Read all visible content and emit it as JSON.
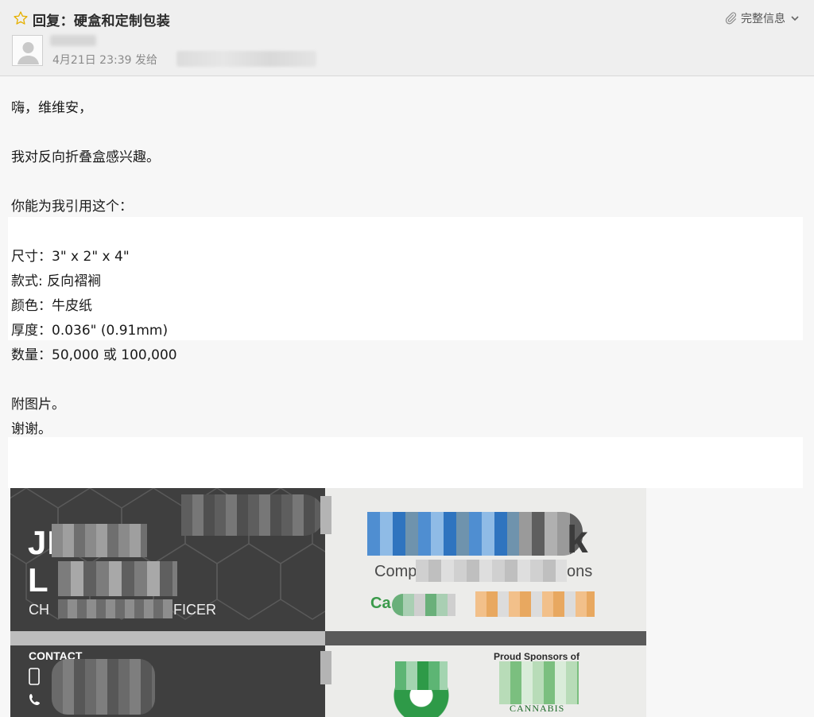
{
  "header": {
    "subject": "回复：硬盒和定制包装",
    "full_info_label": "完整信息",
    "date_time": "4月21日 23:39",
    "sent_to_label": "发给"
  },
  "body": {
    "greeting": "嗨，维维安，",
    "interest": "我对反向折叠盒感兴趣。",
    "request": "你能为我引用这个：",
    "specs": [
      "尺寸：3\" x 2\" x 4\"",
      "款式: 反向褶裥",
      "颜色：牛皮纸",
      "厚度：0.036\" (0.91mm)",
      "数量：50,000 或 100,000"
    ],
    "attachment_note": "附图片。",
    "thanks": "谢谢。"
  },
  "card": {
    "name_line1": "JE",
    "name_line2": "L",
    "title_start": "CH",
    "title_end": "FICER",
    "contact_label": "CONTACT",
    "comp_text": "Comp",
    "ons_text": "ons",
    "brand_k": "k",
    "ca_text": "Ca",
    "sponsors_text": "Proud Sponsors of",
    "cannabis_text": "CANNABIS"
  },
  "colors": {
    "header_bg": "#efefef",
    "star": "#f5c518",
    "card_dark": "#3f3f3f",
    "card_light": "#ececea",
    "green": "#2e9a48"
  }
}
